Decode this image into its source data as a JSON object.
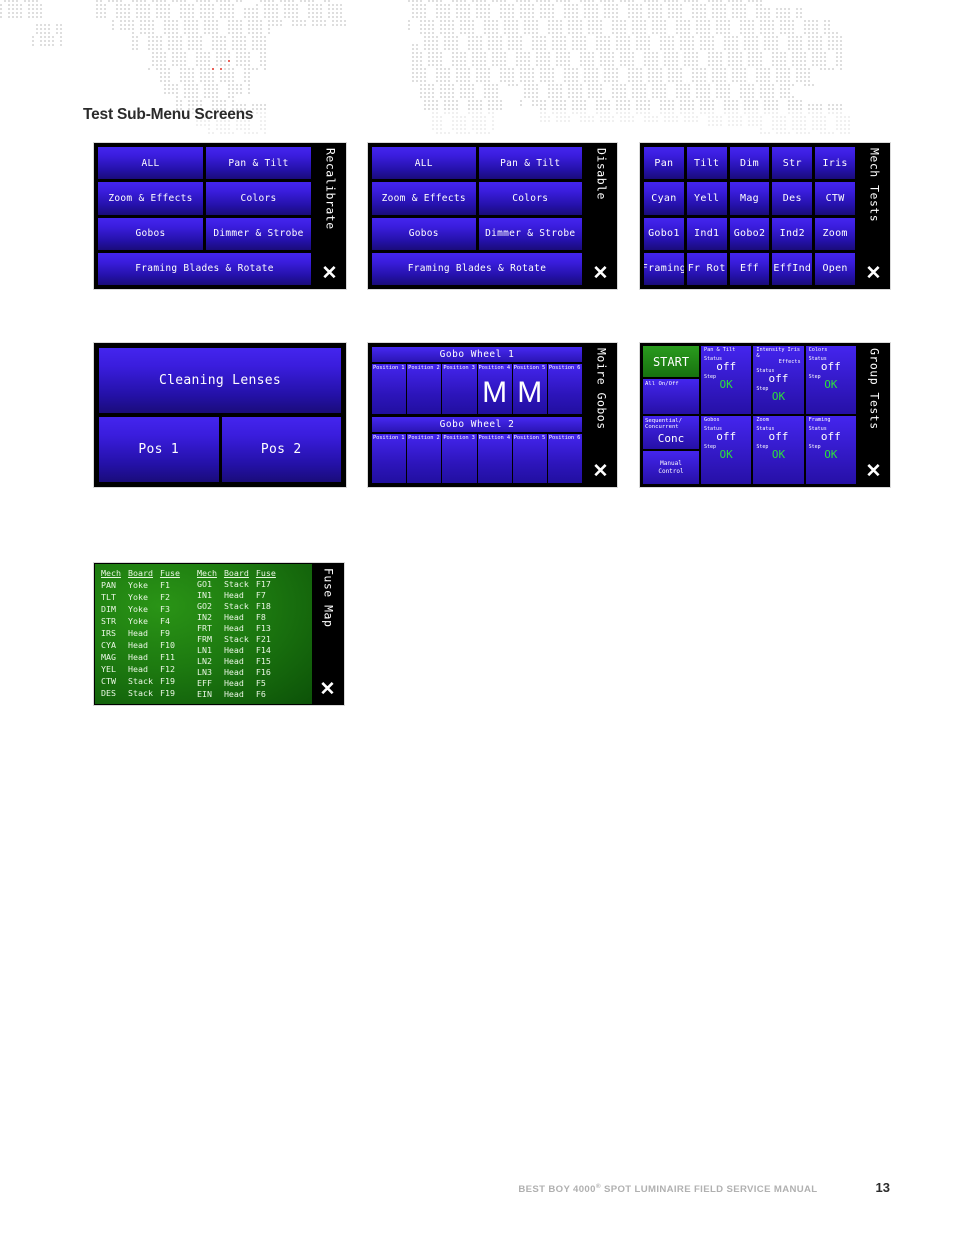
{
  "page": {
    "heading": "Test Sub-Menu Screens",
    "footer_title": "BEST BOY 4000",
    "footer_title_sup": "®",
    "footer_title_rest": " SPOT LUMINAIRE FIELD SERVICE MANUAL",
    "page_number": "13"
  },
  "colors": {
    "button_blue_top": "#4425ee",
    "button_blue_bottom": "#1a0c7a",
    "panel_black": "#000000",
    "green_start": "#2a9b1e",
    "fuse_green": "#1d7a10",
    "status_ok_green": "#2de03a",
    "heading_gray": "#2b2b2b",
    "footer_gray": "#b0b0b0"
  },
  "panels": {
    "recalibrate": {
      "side_label": "Recalibrate",
      "close_label": "✕",
      "rows": [
        [
          "ALL",
          "Pan & Tilt"
        ],
        [
          "Zoom & Effects",
          "Colors"
        ],
        [
          "Gobos",
          "Dimmer & Strobe"
        ],
        [
          "Framing Blades & Rotate"
        ]
      ]
    },
    "disable": {
      "side_label": "Disable",
      "close_label": "✕",
      "rows": [
        [
          "ALL",
          "Pan & Tilt"
        ],
        [
          "Zoom & Effects",
          "Colors"
        ],
        [
          "Gobos",
          "Dimmer & Strobe"
        ],
        [
          "Framing Blades & Rotate"
        ]
      ]
    },
    "mech_tests": {
      "side_label": "Mech Tests",
      "close_label": "✕",
      "rows": [
        [
          "Pan",
          "Tilt",
          "Dim",
          "Str",
          "Iris"
        ],
        [
          "Cyan",
          "Yell",
          "Mag",
          "Des",
          "CTW"
        ],
        [
          "Gobo1",
          "Ind1",
          "Gobo2",
          "Ind2",
          "Zoom"
        ],
        [
          "Framing",
          "Fr Rot",
          "Eff",
          "EffInd",
          "Open"
        ]
      ]
    },
    "cleaning_lenses": {
      "title": "Cleaning Lenses",
      "buttons": [
        "Pos 1",
        "Pos 2"
      ]
    },
    "moire_gobos": {
      "side_label": "Moire Gobos",
      "close_label": "✕",
      "wheels": [
        {
          "title": "Gobo Wheel 1",
          "positions": [
            "Position 1",
            "Position 2",
            "Position 3",
            "Position 4",
            "Position 5",
            "Position 6"
          ],
          "glyphs": [
            "",
            "",
            "",
            "M",
            "M",
            ""
          ]
        },
        {
          "title": "Gobo Wheel 2",
          "positions": [
            "Position 1",
            "Position 2",
            "Position 3",
            "Position 4",
            "Position 5",
            "Position 6"
          ],
          "glyphs": [
            "",
            "",
            "",
            "",
            "",
            ""
          ]
        }
      ]
    },
    "group_tests": {
      "side_label": "Group Tests",
      "close_label": "✕",
      "start_label": "START",
      "all_on_off_label": "All On/Off",
      "seq_conc_label": "Sequential/\nConcurrent",
      "seq_conc_value": "Conc",
      "manual_control_label": "Manual\nControl",
      "status_word": "Status",
      "step_word": "Step",
      "cells": [
        {
          "title": "Pan & Tilt",
          "title2": "",
          "status": "off",
          "step": "OK"
        },
        {
          "title": "Intensity Iris &",
          "title2": "Effects",
          "status": "off",
          "step": "OK"
        },
        {
          "title": "Colors",
          "title2": "",
          "status": "off",
          "step": "OK"
        },
        {
          "title": "Gobos",
          "title2": "",
          "status": "off",
          "step": "OK"
        },
        {
          "title": "Zoom",
          "title2": "",
          "status": "off",
          "step": "OK"
        },
        {
          "title": "Framing",
          "title2": "",
          "status": "off",
          "step": "OK"
        }
      ]
    },
    "fuse_map": {
      "side_label": "Fuse Map",
      "close_label": "✕",
      "headers": [
        "Mech",
        "Board",
        "Fuse"
      ],
      "left_rows": [
        [
          "PAN",
          "Yoke",
          "F1"
        ],
        [
          "TLT",
          "Yoke",
          "F2"
        ],
        [
          "DIM",
          "Yoke",
          "F3"
        ],
        [
          "STR",
          "Yoke",
          "F4"
        ],
        [
          "IRS",
          "Head",
          "F9"
        ],
        [
          "CYA",
          "Head",
          "F10"
        ],
        [
          "MAG",
          "Head",
          "F11"
        ],
        [
          "YEL",
          "Head",
          "F12"
        ],
        [
          "CTW",
          "Stack",
          "F19"
        ],
        [
          "DES",
          "Stack",
          "F19"
        ]
      ],
      "right_rows": [
        [
          "GO1",
          "Stack",
          "F17"
        ],
        [
          "IN1",
          "Head",
          "F7"
        ],
        [
          "GO2",
          "Stack",
          "F18"
        ],
        [
          "IN2",
          "Head",
          "F8"
        ],
        [
          "FRT",
          "Head",
          "F13"
        ],
        [
          "FRM",
          "Stack",
          "F21"
        ],
        [
          "LN1",
          "Head",
          "F14"
        ],
        [
          "LN2",
          "Head",
          "F15"
        ],
        [
          "LN3",
          "Head",
          "F16"
        ],
        [
          "EFF",
          "Head",
          "F5"
        ],
        [
          "EIN",
          "Head",
          "F6"
        ]
      ]
    }
  }
}
